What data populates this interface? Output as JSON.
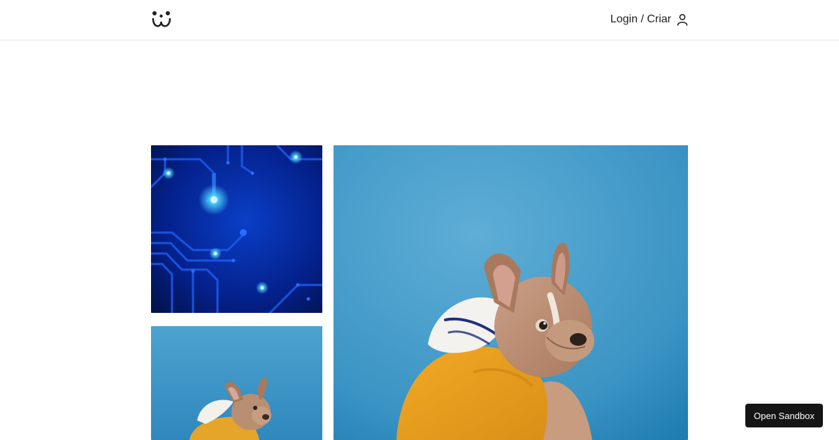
{
  "header": {
    "logo_icon": "smiley-paw-icon",
    "auth_label": "Login / Criar",
    "user_icon": "user-icon"
  },
  "gallery": {
    "items": [
      {
        "kind": "image",
        "subject": "blue circuit board"
      },
      {
        "kind": "image",
        "subject": "french bulldog in yellow hoodie"
      },
      {
        "kind": "image",
        "subject": "french bulldog in yellow hoodie"
      }
    ]
  },
  "sandbox": {
    "label": "Open Sandbox"
  },
  "colors": {
    "circuit_dark": "#031a6b",
    "circuit_glow": "#4fd8ff",
    "sky_blue": "#3f9bcc",
    "hoodie_yellow": "#e6a52a",
    "dog_fawn": "#b98f73"
  }
}
